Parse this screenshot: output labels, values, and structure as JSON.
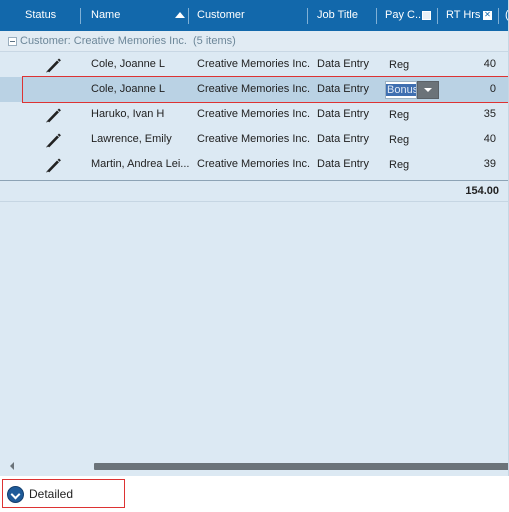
{
  "columns": {
    "status": "Status",
    "name": "Name",
    "customer": "Customer",
    "job_title": "Job Title",
    "pay_code": "Pay C...",
    "rt_hrs": "RT Hrs",
    "extra": "("
  },
  "group": {
    "label": "Customer: Creative Memories Inc.",
    "count": "(5 items)"
  },
  "rows": [
    {
      "name": "Cole, Joanne L",
      "customer": "Creative Memories Inc.",
      "job_title": "Data Entry",
      "pay_code": "Reg",
      "rt_hrs": "40",
      "status_icon": "pencil-icon"
    },
    {
      "name": "Cole, Joanne L",
      "customer": "Creative Memories Inc.",
      "job_title": "Data Entry",
      "pay_code": "Bonus",
      "rt_hrs": "0",
      "status_icon": ""
    },
    {
      "name": "Haruko, Ivan H",
      "customer": "Creative Memories Inc.",
      "job_title": "Data Entry",
      "pay_code": "Reg",
      "rt_hrs": "35",
      "status_icon": "pencil-icon"
    },
    {
      "name": "Lawrence, Emily",
      "customer": "Creative Memories Inc.",
      "job_title": "Data Entry",
      "pay_code": "Reg",
      "rt_hrs": "40",
      "status_icon": "pencil-icon"
    },
    {
      "name": "Martin, Andrea Lei...",
      "customer": "Creative Memories Inc.",
      "job_title": "Data Entry",
      "pay_code": "Reg",
      "rt_hrs": "39",
      "status_icon": "pencil-icon"
    }
  ],
  "total": {
    "rt_hrs": "154.00"
  },
  "footer": {
    "detail_label": "Detailed Timecard"
  },
  "colors": {
    "header_bg": "#1268ab",
    "grid_bg": "#dce9f3",
    "selected_row": "#bad2e4",
    "highlight_outline": "#dd3333"
  }
}
